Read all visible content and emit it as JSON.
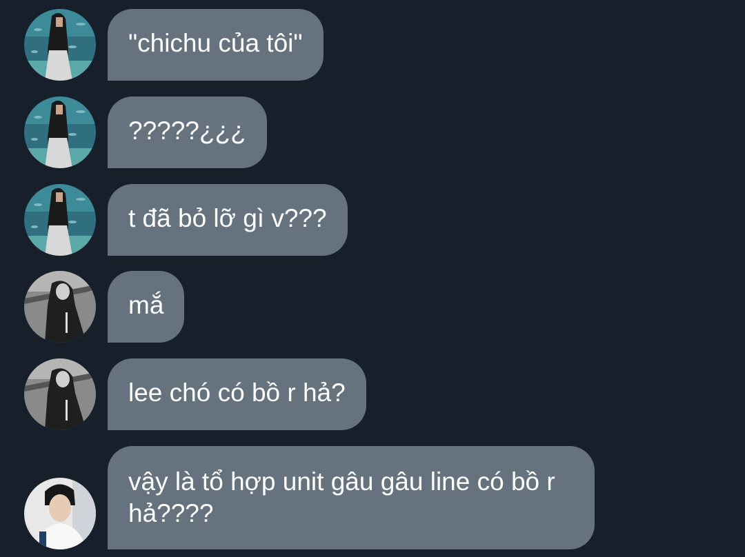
{
  "colors": {
    "background": "#17202a",
    "bubble": "#66737f",
    "text": "#ffffff"
  },
  "messages": [
    {
      "avatar": "avatar-aquarium-girl",
      "text": "\"chichu của tôi\""
    },
    {
      "avatar": "avatar-aquarium-girl",
      "text": "?????¿¿¿"
    },
    {
      "avatar": "avatar-aquarium-girl",
      "text": "t đã bỏ lỡ gì v???"
    },
    {
      "avatar": "avatar-monochrome-boy",
      "text": "mắ"
    },
    {
      "avatar": "avatar-monochrome-boy",
      "text": "lee chó có bồ r hả?"
    },
    {
      "avatar": "avatar-white-shirt-boy",
      "text": "vậy là tổ hợp unit gâu gâu line có bồ r hả????"
    }
  ]
}
